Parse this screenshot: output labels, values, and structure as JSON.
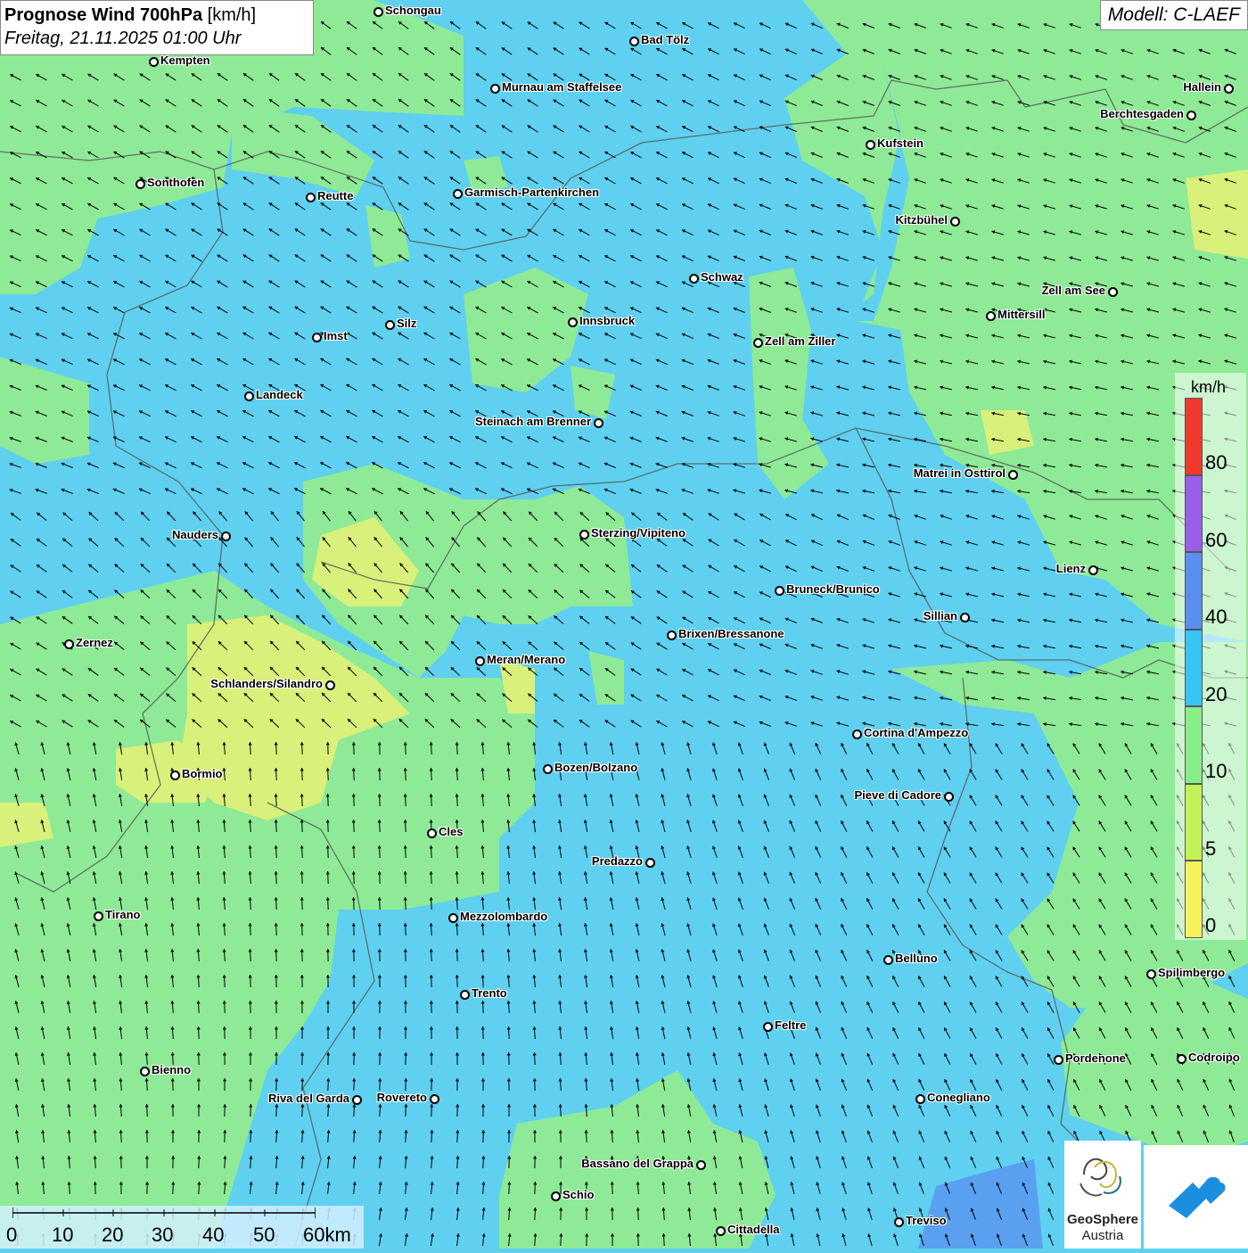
{
  "header": {
    "title_bold": "Prognose Wind 700hPa",
    "title_unit": "[km/h]",
    "datetime": "Freitag, 21.11.2025 01:00 Uhr",
    "model": "Modell: C-LAEF"
  },
  "legend": {
    "unit": "km/h",
    "labels": [
      "80",
      "60",
      "40",
      "20",
      "10",
      "5",
      "0"
    ],
    "colors": [
      "#f03a2e",
      "#9b5ee8",
      "#5a8ef0",
      "#38c4f4",
      "#88ee88",
      "#c4f05a",
      "#f7f25a"
    ]
  },
  "scale": {
    "labels": [
      "0",
      "10",
      "20",
      "30",
      "40",
      "50",
      "60km"
    ]
  },
  "cities": [
    {
      "name": "Schongau",
      "side": "r"
    },
    {
      "name": "Bad Tölz",
      "side": "r"
    },
    {
      "name": "Kempten",
      "side": "r"
    },
    {
      "name": "Murnau am Staffelsee",
      "side": "r"
    },
    {
      "name": "Hallein",
      "side": "l"
    },
    {
      "name": "Berchtesgaden",
      "side": "l"
    },
    {
      "name": "Kufstein",
      "side": "r"
    },
    {
      "name": "Sonthofen",
      "side": "r"
    },
    {
      "name": "Reutte",
      "side": "r"
    },
    {
      "name": "Garmisch-Partenkirchen",
      "side": "r"
    },
    {
      "name": "Kitzbühel",
      "side": "l"
    },
    {
      "name": "Schwaz",
      "side": "r"
    },
    {
      "name": "Zell am See",
      "side": "l"
    },
    {
      "name": "Mittersill",
      "side": "r"
    },
    {
      "name": "Innsbruck",
      "side": "r"
    },
    {
      "name": "Silz",
      "side": "r"
    },
    {
      "name": "Imst",
      "side": "r"
    },
    {
      "name": "Zell am Ziller",
      "side": "r"
    },
    {
      "name": "Landeck",
      "side": "r"
    },
    {
      "name": "Steinach am Brenner",
      "side": "l"
    },
    {
      "name": "Matrei in Osttirol",
      "side": "l"
    },
    {
      "name": "Nauders",
      "side": "l"
    },
    {
      "name": "Sterzing/Vipiteno",
      "side": "r"
    },
    {
      "name": "Lienz",
      "side": "l"
    },
    {
      "name": "Bruneck/Brunico",
      "side": "r"
    },
    {
      "name": "Sillian",
      "side": "l"
    },
    {
      "name": "Brixen/Bressanone",
      "side": "r"
    },
    {
      "name": "Zernez",
      "side": "r"
    },
    {
      "name": "Meran/Merano",
      "side": "r"
    },
    {
      "name": "Schlanders/Silandro",
      "side": "l"
    },
    {
      "name": "Cortina d'Ampezzo",
      "side": "r"
    },
    {
      "name": "Bozen/Bolzano",
      "side": "r"
    },
    {
      "name": "Bormio",
      "side": "r"
    },
    {
      "name": "Pieve di Cadore",
      "side": "l"
    },
    {
      "name": "Cles",
      "side": "r"
    },
    {
      "name": "Predazzo",
      "side": "l"
    },
    {
      "name": "Tirano",
      "side": "r"
    },
    {
      "name": "Mezzolombardo",
      "side": "r"
    },
    {
      "name": "Belluno",
      "side": "r"
    },
    {
      "name": "Spilimbergo",
      "side": "r"
    },
    {
      "name": "Trento",
      "side": "r"
    },
    {
      "name": "Feltre",
      "side": "r"
    },
    {
      "name": "Pordenone",
      "side": "r"
    },
    {
      "name": "Codroipo",
      "side": "r"
    },
    {
      "name": "Bienno",
      "side": "r"
    },
    {
      "name": "Riva del Garda",
      "side": "l"
    },
    {
      "name": "Rovereto",
      "side": "l"
    },
    {
      "name": "Conegliano",
      "side": "r"
    },
    {
      "name": "Bassano del Grappa",
      "side": "l"
    },
    {
      "name": "Schio",
      "side": "r"
    },
    {
      "name": "Treviso",
      "side": "r"
    },
    {
      "name": "Cittadella",
      "side": "r"
    }
  ],
  "logos": {
    "geosphere_line1": "GeoSphere",
    "geosphere_line2": "Austria"
  }
}
